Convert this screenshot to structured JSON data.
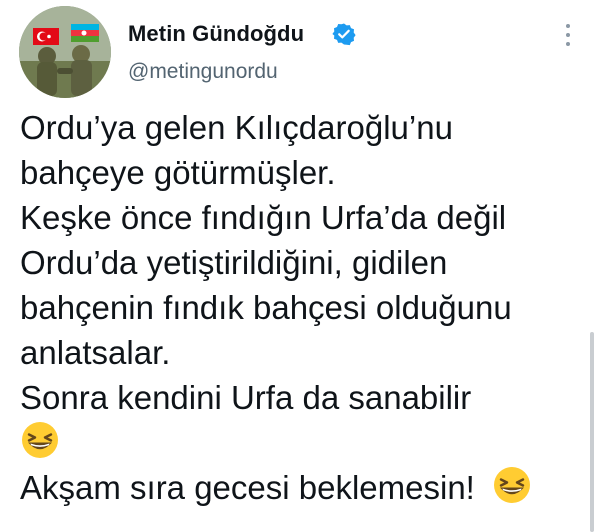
{
  "author": {
    "display_name": "Metin Gündoğdu",
    "handle": "@metingunordu",
    "verified": true,
    "avatar": "soldiers-with-flags-avatar"
  },
  "tweet": {
    "lines": [
      "Ordu’ya gelen Kılıçdaroğlu’nu",
      "bahçeye götürmüşler.",
      "Keşke önce fındığın Urfa’da değil",
      "Ordu’da yetiştirildiğini, gidilen",
      "bahçenin fındık bahçesi olduğunu",
      "anlatsalar.",
      "Sonra kendini Urfa da sanabilir",
      "",
      "Akşam sıra gecesi beklemesin!"
    ],
    "emoji": "grinning-squinting-face-emoji"
  },
  "icons": {
    "verified": "verified-badge-icon",
    "more": "more-options-icon"
  },
  "colors": {
    "verified": "#1d9bf0",
    "text": "#0f1419",
    "secondary": "#536471",
    "emoji": "#ffcc32"
  }
}
